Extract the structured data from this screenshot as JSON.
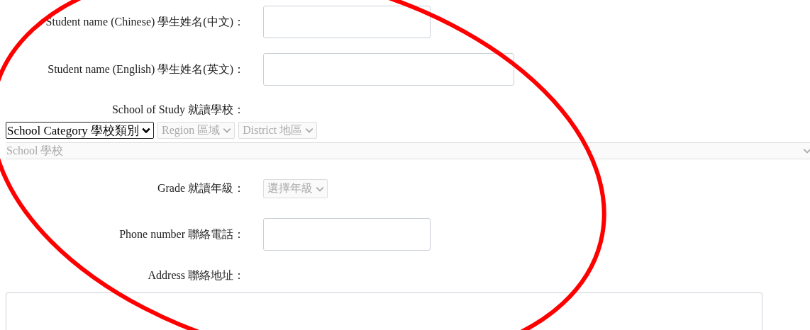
{
  "student_name_chinese": {
    "label": "Student name (Chinese) 學生姓名(中文)："
  },
  "student_name_english": {
    "label": "Student name (English) 學生姓名(英文)："
  },
  "school_of_study": {
    "label": "School of Study 就讀學校：",
    "filters": [
      {
        "value": "School Category 學校類別",
        "disabled": false
      },
      {
        "value": "Region 區域",
        "disabled": true
      },
      {
        "value": "District 地區",
        "disabled": true
      }
    ],
    "school": {
      "value": "School 學校",
      "disabled": true
    }
  },
  "grade": {
    "label": "Grade 就讀年級：",
    "select": {
      "value": "選擇年級",
      "disabled": true
    }
  },
  "phone": {
    "label": "Phone number 聯絡電話："
  },
  "address": {
    "label": "Address 聯絡地址："
  },
  "annotation": {
    "kind": "ellipse"
  }
}
